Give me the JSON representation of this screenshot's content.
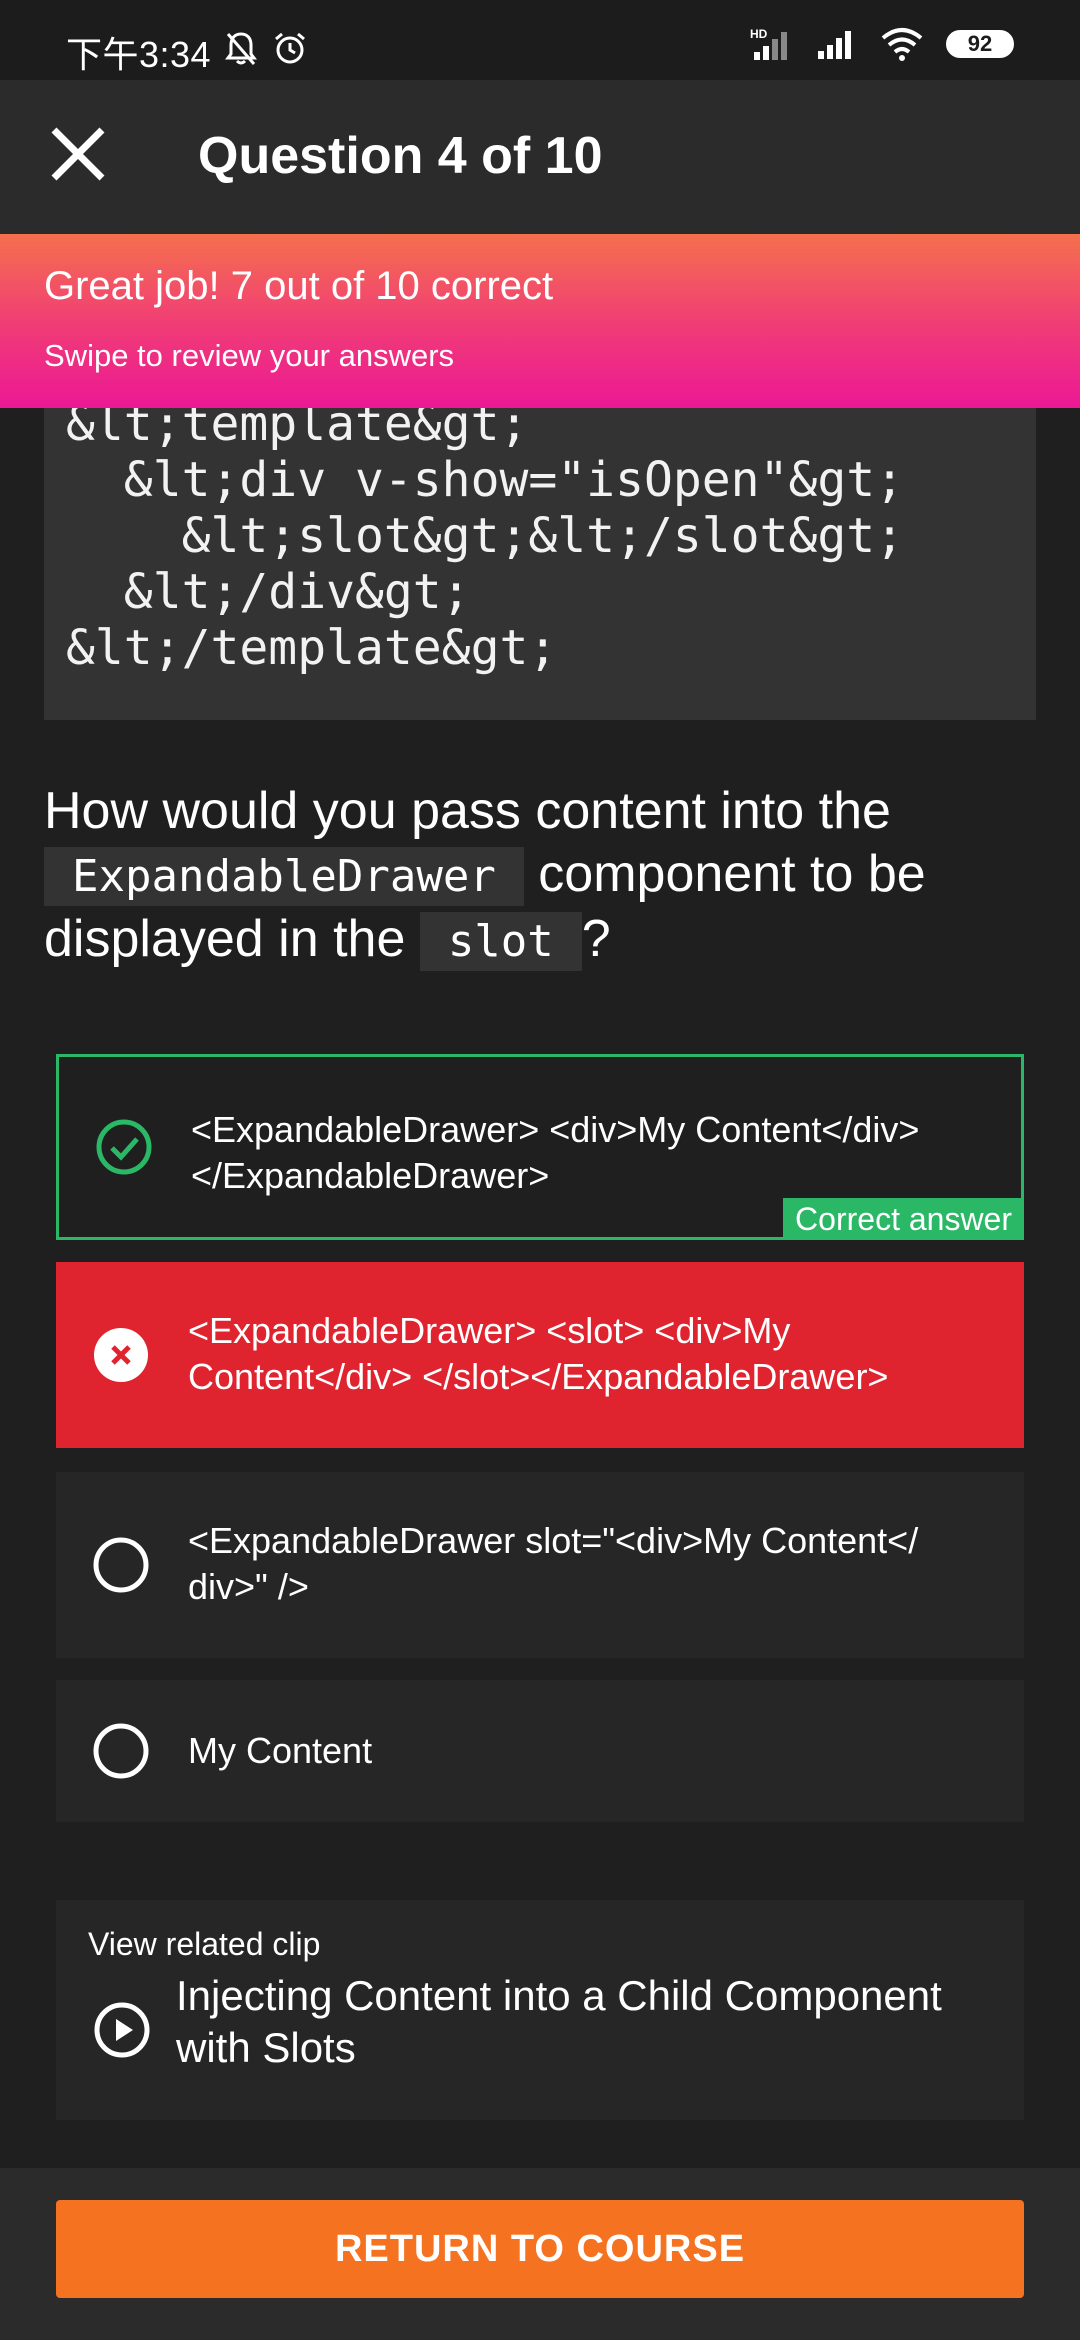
{
  "status": {
    "time": "下午3:34",
    "network": "HD",
    "battery": "92"
  },
  "header": {
    "title": "Question 4 of 10"
  },
  "banner": {
    "title": "Great job! 7 out of 10 correct",
    "subtitle": "Swipe to review your answers"
  },
  "code": {
    "text": "&lt;template&gt;\n  &lt;div v-show=\"isOpen\"&gt;\n    &lt;slot&gt;&lt;/slot&gt;\n  &lt;/div&gt;\n&lt;/template&gt;"
  },
  "question": {
    "part1": "How would you pass content into the",
    "code1": "ExpandableDrawer",
    "part2": "component to be displayed in the",
    "code2": "slot",
    "part3": "?"
  },
  "options": [
    {
      "text": "<ExpandableDrawer> <div>My Content</div> </ExpandableDrawer>",
      "status": "correct",
      "tag": "Correct answer"
    },
    {
      "text": "<ExpandableDrawer>  <slot> <div>My Content</div> </slot></ExpandableDrawer>",
      "status": "selected-wrong"
    },
    {
      "text": "<ExpandableDrawer slot=\"<div>My Content</ div>\" />",
      "status": "unselected"
    },
    {
      "text": "My Content",
      "status": "unselected"
    }
  ],
  "clip": {
    "label": "View related clip",
    "title": "Injecting Content into a Child Component with Slots"
  },
  "footer": {
    "button": "RETURN TO COURSE"
  },
  "colors": {
    "correct": "#2bb866",
    "wrong": "#e0242f",
    "accent": "#f57220"
  }
}
